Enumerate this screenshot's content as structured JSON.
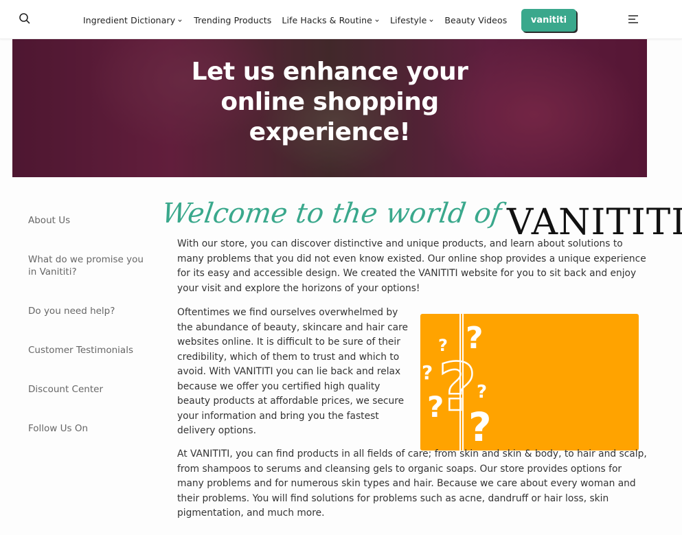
{
  "header": {
    "nav": [
      {
        "label": "Ingredient Dictionary",
        "dropdown": true
      },
      {
        "label": "Trending Products",
        "dropdown": false
      },
      {
        "label": "Life Hacks & Routine",
        "dropdown": true
      },
      {
        "label": "Lifestyle",
        "dropdown": true
      },
      {
        "label": "Beauty Videos",
        "dropdown": false
      }
    ],
    "cta_label": "vanititi",
    "accent_color": "#3aa88c"
  },
  "hero": {
    "title_line1": "Let us enhance your",
    "title_line2": "online shopping",
    "title_line3": "experience!"
  },
  "sidebar": {
    "items": [
      {
        "label": "About Us"
      },
      {
        "label": "What do we promise you in Vanititi?"
      },
      {
        "label": "Do you need help?"
      },
      {
        "label": "Customer Testimonials"
      },
      {
        "label": "Discount Center"
      },
      {
        "label": "Follow Us On"
      }
    ]
  },
  "main": {
    "welcome": "Welcome to the world of",
    "logo": "VANITITI",
    "para1": "With our store, you can discover distinctive and unique products, and learn about solutions to many problems that you did not even know existed. Our online shop provides a unique experience for its easy and accessible design. We created the VANITITI website for you to sit back and enjoy your visit and explore the horizons of your options!",
    "para2": "Oftentimes we find ourselves overwhelmed by the abundance of beauty, skincare and hair care websites online. It is difficult to be sure of their credibility, which of them to trust and which to avoid. With VANITITI you can lie back and relax because we offer you certified high quality beauty products at affordable prices, we secure your information and bring you the fastest delivery options.",
    "para3": "At VANITITI, you can find products in all fields of care; from skin and skin & body, to hair and scalp, from shampoos to serums and cleansing gels to organic soaps. Our store provides options for many problems and for numerous skin types and hair. Because we care about every woman and their problems. You will find solutions for problems such as acne, dandruff or hair loss, skin pigmentation, and much more.",
    "image_color": "#ffa300"
  }
}
